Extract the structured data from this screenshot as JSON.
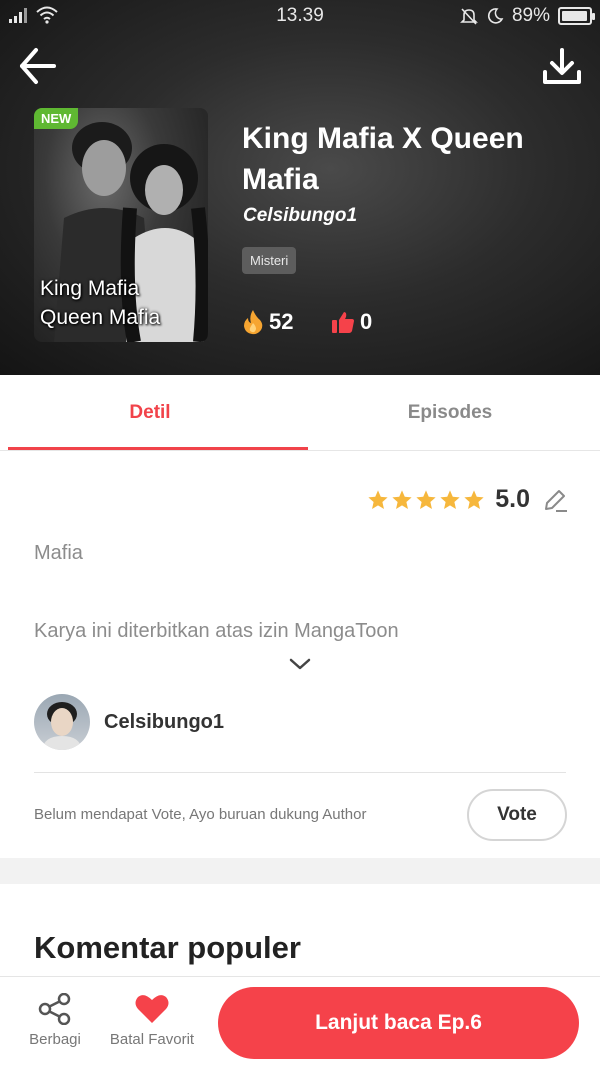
{
  "status_bar": {
    "time": "13.39",
    "battery": "89%",
    "battery_level": 0.89,
    "icons": [
      "signal-icon",
      "wifi-icon",
      "mute-icon",
      "moon-icon",
      "battery-icon"
    ]
  },
  "header": {
    "back_icon": "arrow-left-icon",
    "download_icon": "download-icon",
    "cover": {
      "badge": "NEW",
      "text_line1": "King Mafia",
      "text_line2": "Queen Mafia"
    },
    "title": "King Mafia X Queen Mafia",
    "author": "Celsibungo1",
    "genre": "Misteri",
    "likes": "52",
    "dislikes": "0"
  },
  "tabs": [
    {
      "label": "Detil",
      "active": true
    },
    {
      "label": "Episodes",
      "active": false
    }
  ],
  "detail": {
    "rating": "5.0",
    "stars": 5,
    "tag": "Mafia",
    "license": "Karya ini diterbitkan atas izin MangaToon",
    "author_name": "Celsibungo1",
    "vote_message": "Belum mendapat Vote, Ayo buruan dukung Author",
    "vote_label": "Vote",
    "comments_title": "Komentar populer"
  },
  "bottom_bar": {
    "share_label": "Berbagi",
    "favorite_label": "Batal Favorit",
    "continue_label": "Lanjut baca Ep.6"
  },
  "colors": {
    "accent": "#f5424a",
    "tab_active": "#f1434a",
    "star": "#f6b73c",
    "badge_new": "#5fb832"
  }
}
